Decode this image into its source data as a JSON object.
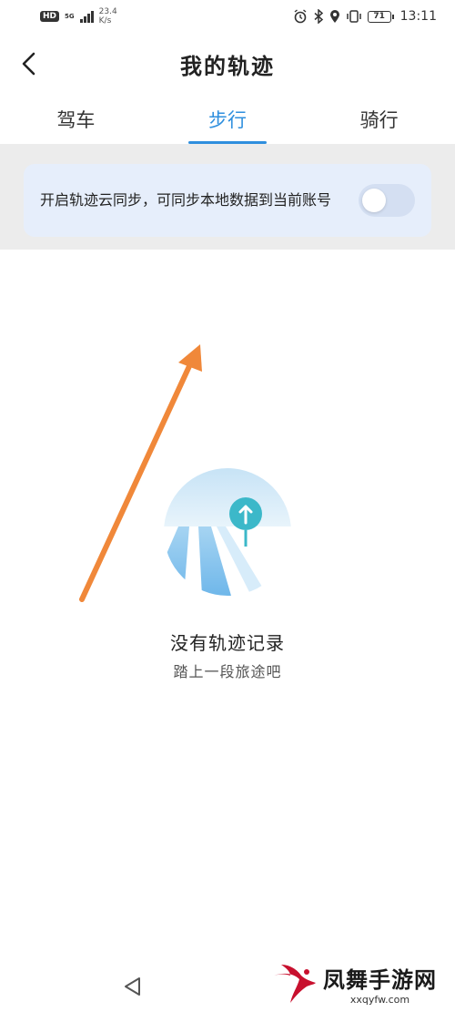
{
  "status_bar": {
    "hd": "HD",
    "network": "5G",
    "speed_value": "23.4",
    "speed_unit": "K/s",
    "battery": "71",
    "time": "13:11"
  },
  "header": {
    "title": "我的轨迹"
  },
  "tabs": [
    {
      "label": "驾车",
      "active": false
    },
    {
      "label": "步行",
      "active": true
    },
    {
      "label": "骑行",
      "active": false
    }
  ],
  "sync": {
    "text": "开启轨迹云同步，可同步本地数据到当前账号",
    "enabled": false
  },
  "empty_state": {
    "title": "没有轨迹记录",
    "subtitle": "踏上一段旅途吧"
  },
  "watermark": {
    "brand": "凤舞手游网",
    "url": "xxqyfw.com"
  },
  "colors": {
    "accent": "#2f8fde",
    "annotation_arrow": "#f0883a"
  }
}
